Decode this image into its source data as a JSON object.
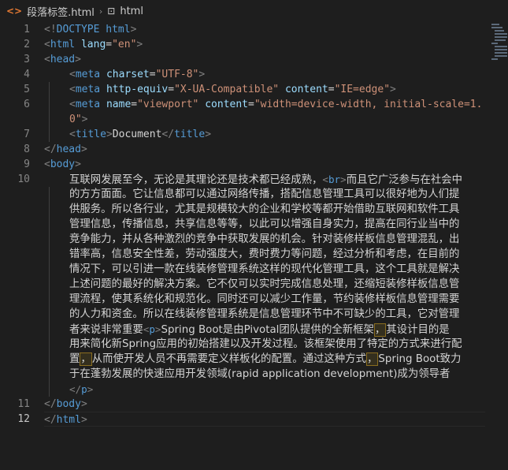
{
  "breadcrumb": {
    "file_icon": "<>",
    "filename": "段落标签.html",
    "separator": "›",
    "tag_icon": "⊡",
    "element": "html"
  },
  "gutter": {
    "line_numbers": [
      "1",
      "2",
      "3",
      "4",
      "5",
      "",
      "6",
      "",
      "7",
      "8",
      "9",
      "10",
      "",
      "",
      "",
      "",
      "",
      "",
      "",
      "",
      "",
      "",
      "",
      "",
      "",
      "",
      "11",
      "12"
    ]
  },
  "code": {
    "l1": {
      "bracket": "<!",
      "tag": "DOCTYPE",
      "rest": " html",
      "close": ">"
    },
    "l2": {
      "open": "<",
      "tag": "html",
      "attr": " lang",
      "eq": "=",
      "val": "\"en\"",
      "close": ">"
    },
    "l3": {
      "open": "<",
      "tag": "head",
      "close": ">"
    },
    "l4": {
      "open": "<",
      "tag": "meta",
      "attr": " charset",
      "eq": "=",
      "val": "\"UTF-8\"",
      "close": ">"
    },
    "l5": {
      "open": "<",
      "tag": "meta",
      "attr1": " http-equiv",
      "eq1": "=",
      "val1": "\"X-UA-Compatible\"",
      "attr2": " content",
      "eq2": "=",
      "val2": "\"IE=edge\"",
      "close": ">"
    },
    "l6a": {
      "open": "<",
      "tag": "meta",
      "attr1": " name",
      "eq1": "=",
      "val1": "\"viewport\"",
      "attr2": " content",
      "eq2": "=",
      "val2": "\"width=device-width, initial-scale=1."
    },
    "l6b": {
      "val": "0\"",
      "close": ">"
    },
    "l7": {
      "open": "<",
      "tag": "title",
      "close": ">",
      "text": "Document",
      "open2": "</",
      "tag2": "title",
      "close2": ">"
    },
    "l8": {
      "open": "</",
      "tag": "head",
      "close": ">"
    },
    "l9": {
      "open": "<",
      "tag": "body",
      "close": ">"
    },
    "l10_rows": {
      "r1a": "互联网发展至今，无论是其理论还是技术都已经成熟，",
      "r1tag_open": "<",
      "r1tag": "br",
      "r1tag_close": ">",
      "r1b": "而且它广泛参与在社会中",
      "r2": "的方方面面。它让信息都可以通过网络传播，搭配信息管理工具可以很好地为人们提",
      "r3": "供服务。所以各行业，尤其是规模较大的企业和学校等都开始借助互联网和软件工具",
      "r4": "管理信息，传播信息，共享信息等等，以此可以增强自身实力，提高在同行业当中的",
      "r5": "竞争能力，并从各种激烈的竞争中获取发展的机会。针对装修样板信息管理混乱，出",
      "r6": "错率高，信息安全性差，劳动强度大，费时费力等问题，经过分析和考虑，在目前的",
      "r7": "情况下，可以引进一款在线装修管理系统这样的现代化管理工具，这个工具就是解决",
      "r8": "上述问题的最好的解决方案。它不仅可以实时完成信息处理，还缩短装修样板信息管",
      "r9": "理流程，使其系统化和规范化。同时还可以减少工作量，节约装修样板信息管理需要",
      "r10": "的人力和资金。所以在线装修管理系统是信息管理环节中不可缺少的工具，它对管理",
      "r11a": "者来说非常重要",
      "r11tag_open": "<",
      "r11tag": "p",
      "r11tag_close": ">",
      "r11b": "Spring Boot是由Pivotal团队提供的全新框架",
      "r11hl": "，",
      "r11c": "其设计目的是",
      "r12": "用来简化新Spring应用的初始搭建以及开发过程。该框架使用了特定的方式来进行配",
      "r13a": "置",
      "r13hl": "，",
      "r13b": "从而使开发人员不再需要定义样板化的配置。通过这种方式",
      "r13hl2": "，",
      "r13c": "Spring Boot致力",
      "r14": "于在蓬勃发展的快速应用开发领域(rapid application development)成为领导者",
      "r15open": "</",
      "r15tag": "p",
      "r15close": ">"
    },
    "l11": {
      "open": "</",
      "tag": "body",
      "close": ">"
    },
    "l12": {
      "open": "</",
      "tag": "html",
      "close": ">"
    }
  },
  "colors": {
    "background": "#1e1e1e",
    "tag": "#569cd6",
    "attribute": "#9cdcfe",
    "string": "#ce9178",
    "bracket": "#808080",
    "text": "#d4d4d4",
    "line_number": "#858585"
  }
}
